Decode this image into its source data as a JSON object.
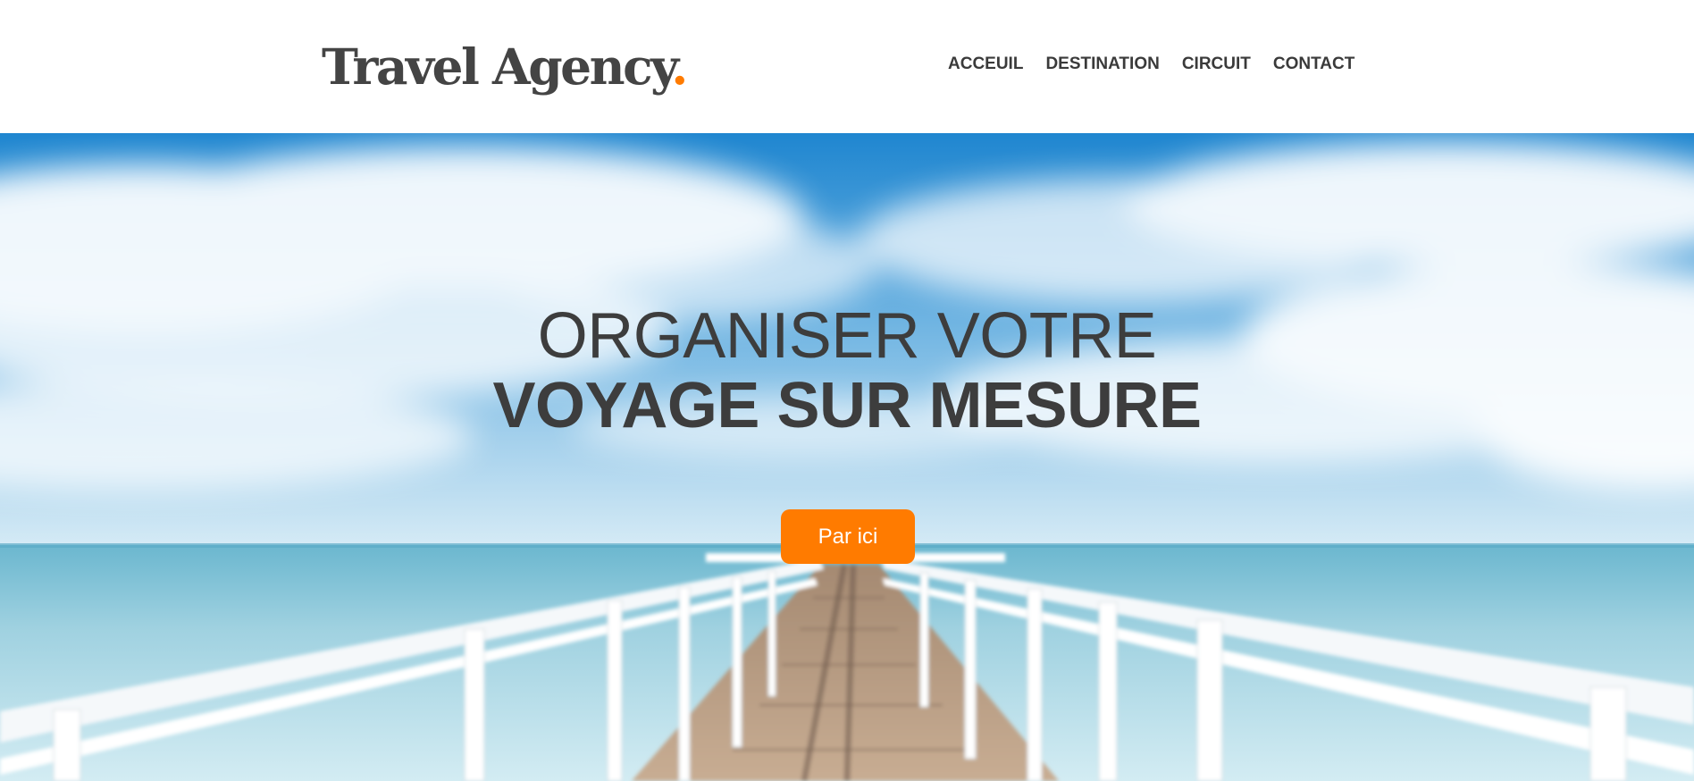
{
  "brand": {
    "name": "Travel Agency",
    "dot": ".",
    "accent_color": "#ff7b00"
  },
  "nav": {
    "items": [
      "ACCEUIL",
      "DESTINATION",
      "CIRCUIT",
      "CONTACT"
    ]
  },
  "hero": {
    "line1": "ORGANISER VOTRE",
    "line2": "VOYAGE SUR MESURE",
    "cta_label": "Par ici",
    "image": "pier-over-sea-photo"
  }
}
